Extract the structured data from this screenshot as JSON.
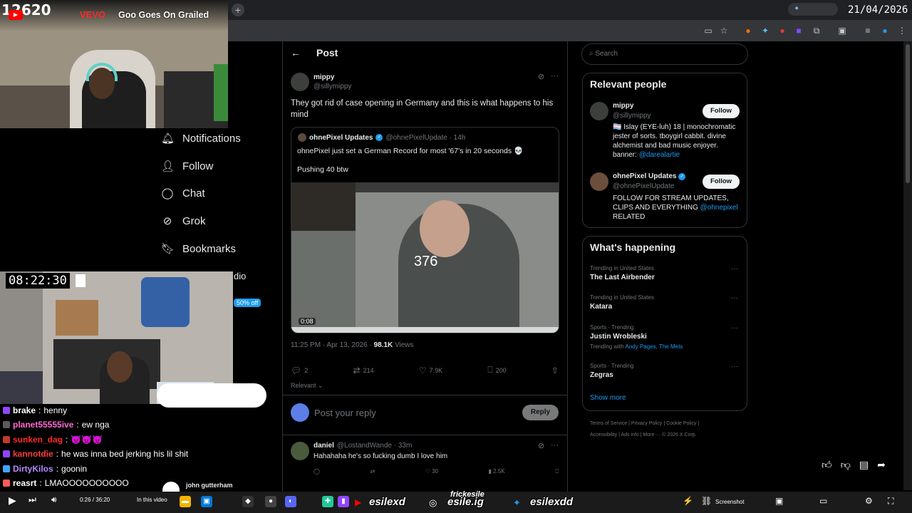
{
  "browser": {
    "add_tab": "+",
    "date": "21/04/2026",
    "extension_pill": ""
  },
  "stream": {
    "view_count": "12620",
    "video_title": "Goo Goes On Grailed",
    "overlay_title": "VEVO",
    "timer": "08:22:30"
  },
  "left_nav": {
    "items": [
      {
        "icon": "bell-icon",
        "label": "Notifications"
      },
      {
        "icon": "add-user-icon",
        "label": "Follow"
      },
      {
        "icon": "chat-icon",
        "label": "Chat"
      },
      {
        "icon": "grok-icon",
        "label": "Grok"
      },
      {
        "icon": "bookmark-icon",
        "label": "Bookmarks"
      }
    ],
    "partial_label": "dio",
    "discount_badge": "50% off"
  },
  "post": {
    "header": "Post",
    "author_name": "mippy",
    "author_handle": "@sillymippy",
    "text": "They got rid of case opening in Germany and this is what happens to his mind",
    "quote": {
      "name": "ohnePixel Updates",
      "handle": "@ohnePixelUpdate · 14h",
      "text": "ohnePixel just set a German Record for most '67's in 20 seconds 💀",
      "text2": "Pushing 40 btw",
      "video_counter": "376",
      "video_time": "0:08"
    },
    "timestamp": "11:25 PM · Apr 13, 2026 · ",
    "views_count": "98.1K",
    "views_label": " Views",
    "actions": {
      "replies": "2",
      "reposts": "214",
      "likes": "7.9K",
      "bookmarks": "200"
    },
    "sort_label": "Relevant"
  },
  "reply_box": {
    "placeholder": "Post your reply",
    "button": "Reply"
  },
  "reply": {
    "name": "daniel",
    "handle": "@LostandWande · 33m",
    "text": "Hahahaha he's so fucking dumb I love him",
    "likes": "30",
    "views": "2.5K"
  },
  "sidebar": {
    "search_placeholder": "Search",
    "relevant_title": "Relevant people",
    "people": [
      {
        "name": "mippy",
        "handle": "@sillymippy",
        "follow": "Follow",
        "bio": "🏳️‍⚧️ Islay (EYE-luh) 18 | monochromatic jester of sorts. tboygirl cabbit. divine alchemist and bad music enjoyer. banner: ",
        "bio_link": "@darealartie"
      },
      {
        "name": "ohnePixel Updates",
        "handle": "@ohnePixelUpdate",
        "follow": "Follow",
        "bio": "FOLLOW FOR STREAM UPDATES, CLIPS AND EVERYTHING ",
        "bio_link": "@ohnepixel",
        "bio_tail": " RELATED"
      }
    ],
    "happening_title": "What's happening",
    "trends": [
      {
        "context": "Trending in United States",
        "name": "The Last Airbender",
        "extra": ""
      },
      {
        "context": "Trending in United States",
        "name": "Katara",
        "extra": ""
      },
      {
        "context": "Sports · Trending",
        "name": "Justin Wrobleski",
        "extra": "Trending with ",
        "extra_link": "Andy Pages, The Mets"
      },
      {
        "context": "Sports · Trending",
        "name": "Zegras",
        "extra": ""
      }
    ],
    "show_more": "Show more",
    "footer_line1": "Terms of Service  |  Privacy Policy  |  Cookie Policy  |",
    "footer_line2": "Accessibility  |  Ads info  |  More ···  © 2026 X Corp."
  },
  "chat": [
    {
      "user": "brake",
      "msg": "henny",
      "color": "#ffffff"
    },
    {
      "user": "planet55555ive",
      "msg": "ew nga",
      "color": "#ff6ad5"
    },
    {
      "user": "sunken_dag",
      "msg": "👿👿👿",
      "color": "#ff2a2a"
    },
    {
      "user": "kannotdie",
      "msg": "he was inna bed jerking his lil shit",
      "color": "#ff3b3b"
    },
    {
      "user": "DirtyKilos",
      "msg": "goonin",
      "color": "#b28cff"
    },
    {
      "user": "reasrt",
      "msg": "LMAOOOOOOOOOO",
      "color": "#ffffff"
    }
  ],
  "overlay": {
    "john_label": "john gutterham",
    "yt_time": "0:26 / 36:20",
    "in_this_video": "In this video",
    "social_top": "frickesile",
    "social_1": "esilexd",
    "social_2": "esile.ig",
    "social_3": "esilexdd",
    "screenshot": "Screenshot"
  },
  "colors": {
    "x_blue": "#1d9bf0",
    "background": "#000000",
    "border": "#2f3336"
  }
}
